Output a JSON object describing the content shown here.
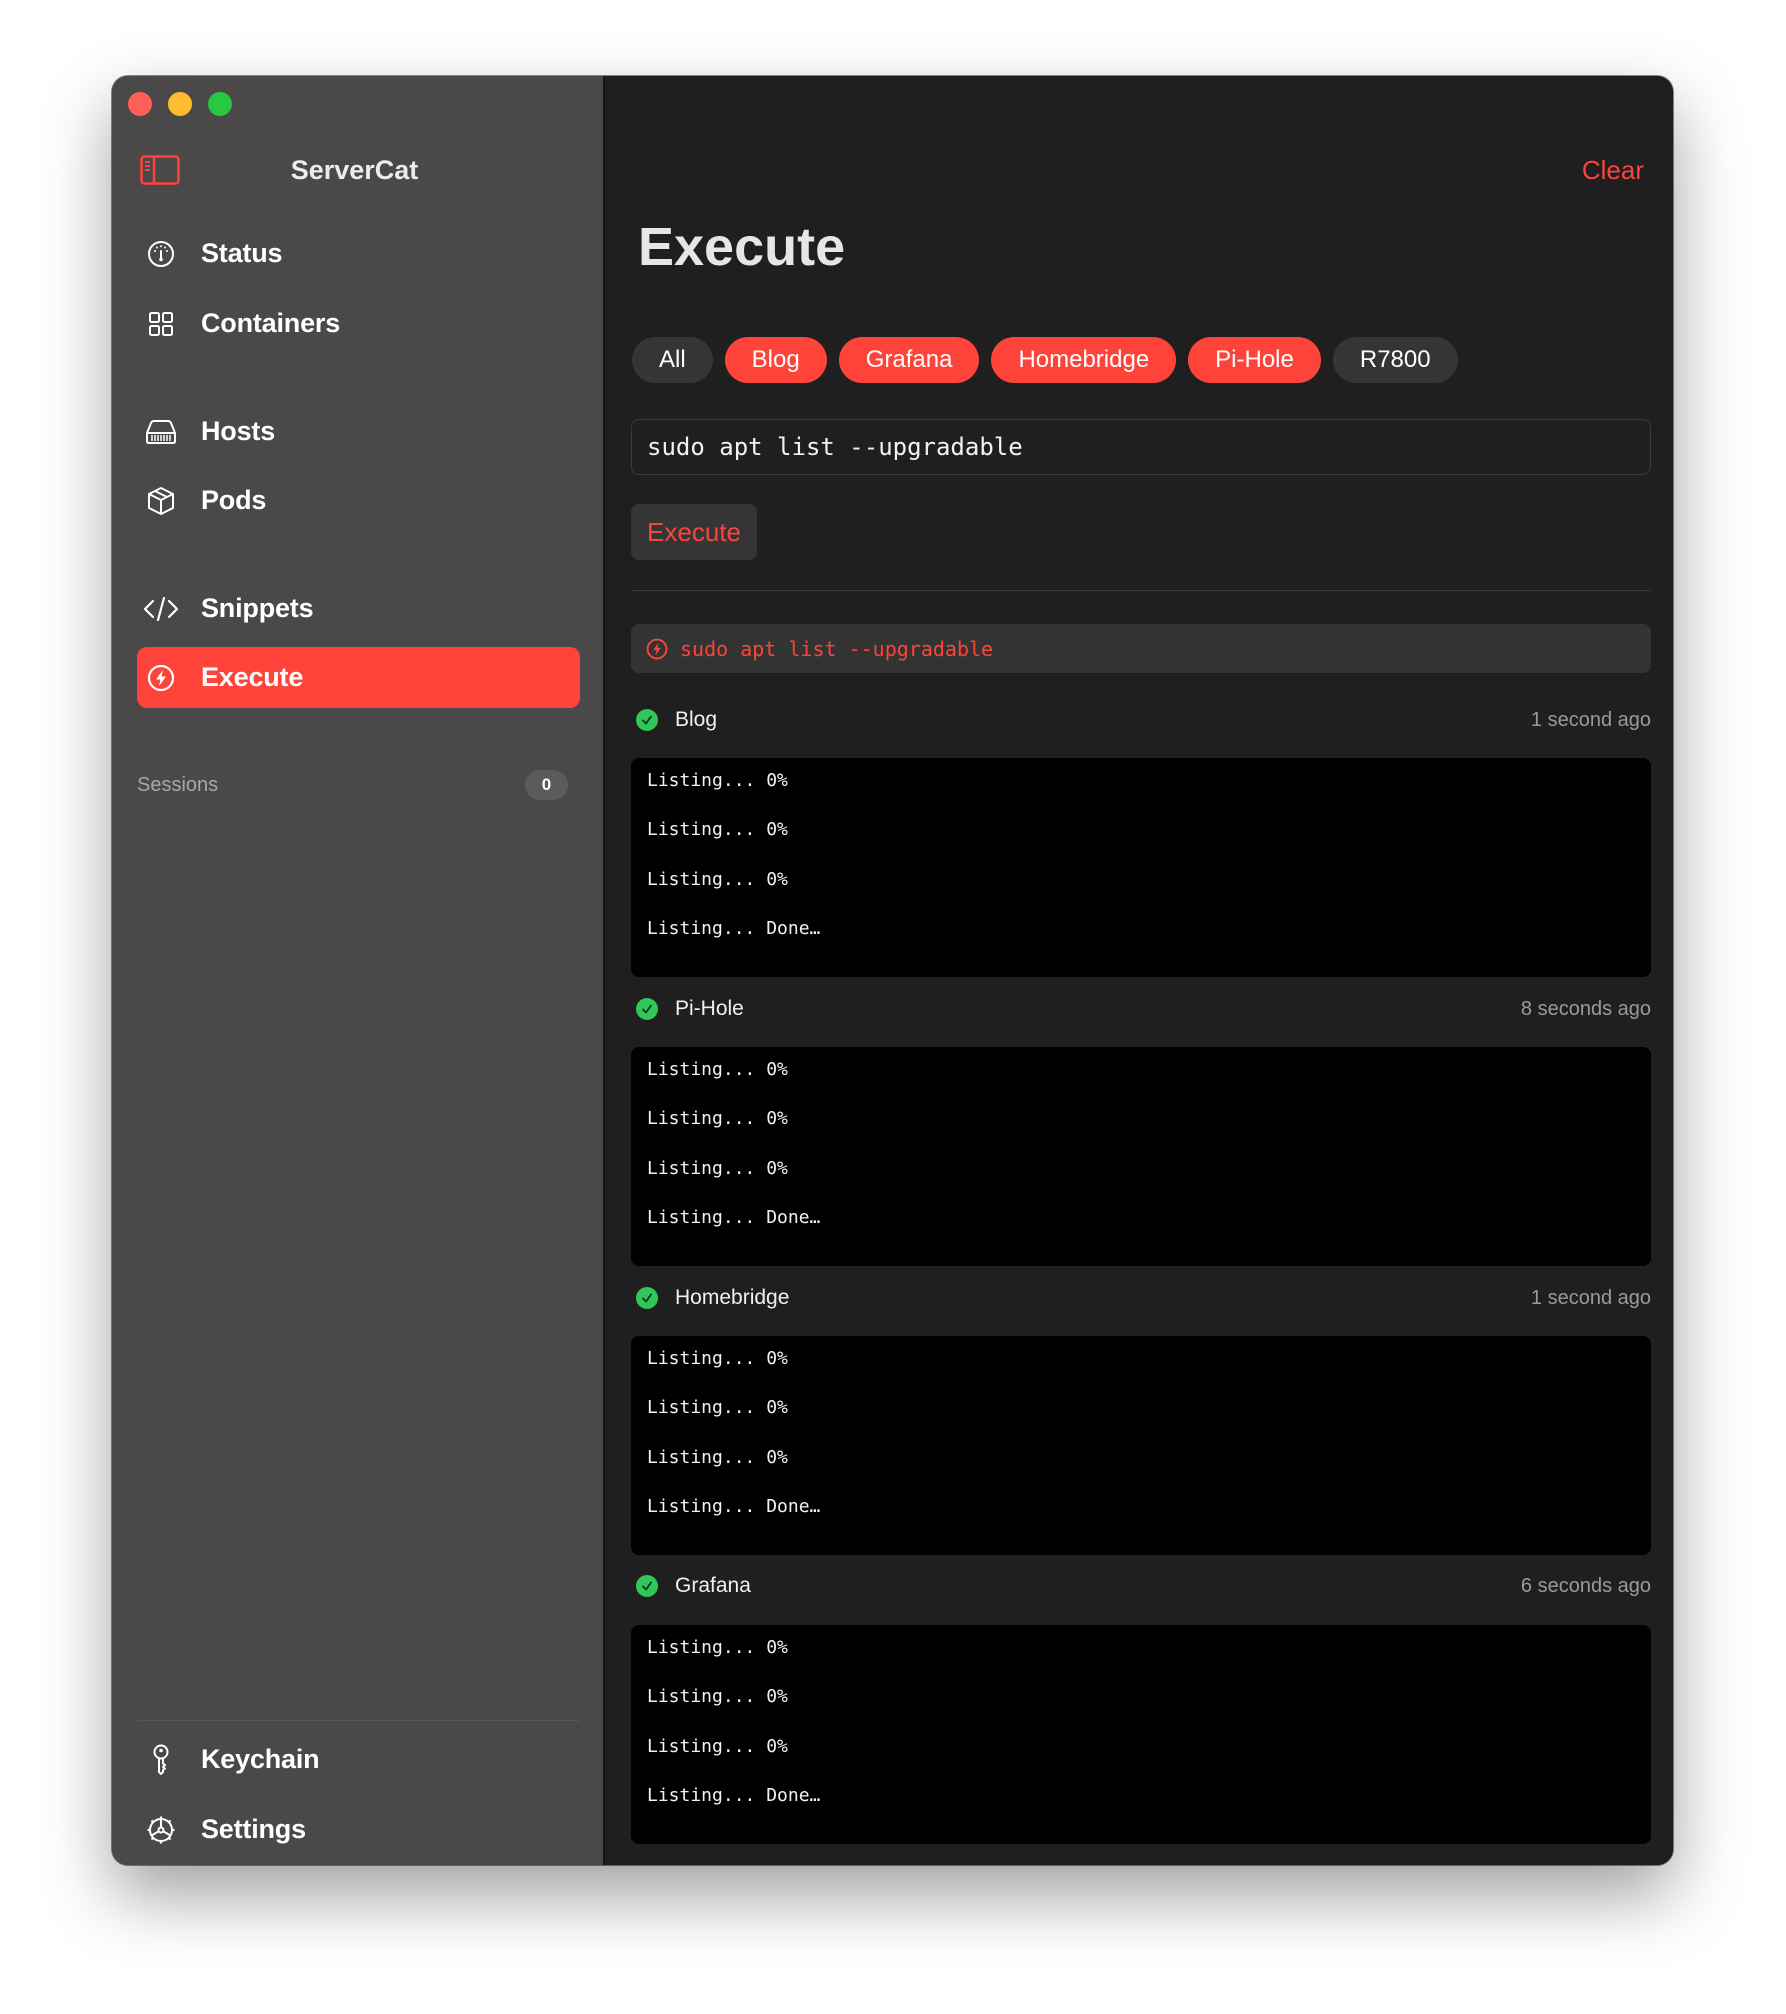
{
  "app": {
    "title": "ServerCat",
    "accent_color": "#fe443a"
  },
  "window_controls": {
    "close_color": "#ff5f57",
    "minimize_color": "#febc2e",
    "zoom_color": "#28c840"
  },
  "sidebar": {
    "toggle_icon": "sidebar-left-icon",
    "items": [
      {
        "label": "Status",
        "icon": "gauge-icon",
        "active": false
      },
      {
        "label": "Containers",
        "icon": "grid-icon",
        "active": false
      },
      {
        "label": "Hosts",
        "icon": "server-rack-icon",
        "active": false
      },
      {
        "label": "Pods",
        "icon": "cube-box-icon",
        "active": false
      },
      {
        "label": "Snippets",
        "icon": "code-brackets-icon",
        "active": false
      },
      {
        "label": "Execute",
        "icon": "bolt-circle-icon",
        "active": true
      }
    ],
    "sessions": {
      "label": "Sessions",
      "count": "0"
    },
    "footer_items": [
      {
        "label": "Keychain",
        "icon": "key-icon"
      },
      {
        "label": "Settings",
        "icon": "gear-icon"
      }
    ]
  },
  "main": {
    "clear_label": "Clear",
    "title": "Execute",
    "host_chips": [
      {
        "label": "All",
        "selected": false
      },
      {
        "label": "Blog",
        "selected": true
      },
      {
        "label": "Grafana",
        "selected": true
      },
      {
        "label": "Homebridge",
        "selected": true
      },
      {
        "label": "Pi-Hole",
        "selected": true
      },
      {
        "label": "R7800",
        "selected": false
      }
    ],
    "command_input": {
      "value": "sudo apt list --upgradable"
    },
    "execute_button_label": "Execute",
    "last_command": {
      "icon": "bolt-circle-icon",
      "text": "sudo apt list --upgradable"
    },
    "results": [
      {
        "host": "Blog",
        "status": "success",
        "time": "1 second ago",
        "output": [
          "Listing... 0%",
          "Listing... 0%",
          "Listing... 0%",
          "Listing... Done…"
        ]
      },
      {
        "host": "Pi-Hole",
        "status": "success",
        "time": "8 seconds ago",
        "output": [
          "Listing... 0%",
          "Listing... 0%",
          "Listing... 0%",
          "Listing... Done…"
        ]
      },
      {
        "host": "Homebridge",
        "status": "success",
        "time": "1 second ago",
        "output": [
          "Listing... 0%",
          "Listing... 0%",
          "Listing... 0%",
          "Listing... Done…"
        ]
      },
      {
        "host": "Grafana",
        "status": "success",
        "time": "6 seconds ago",
        "output": [
          "Listing... 0%",
          "Listing... 0%",
          "Listing... 0%",
          "Listing... Done…"
        ]
      }
    ]
  }
}
